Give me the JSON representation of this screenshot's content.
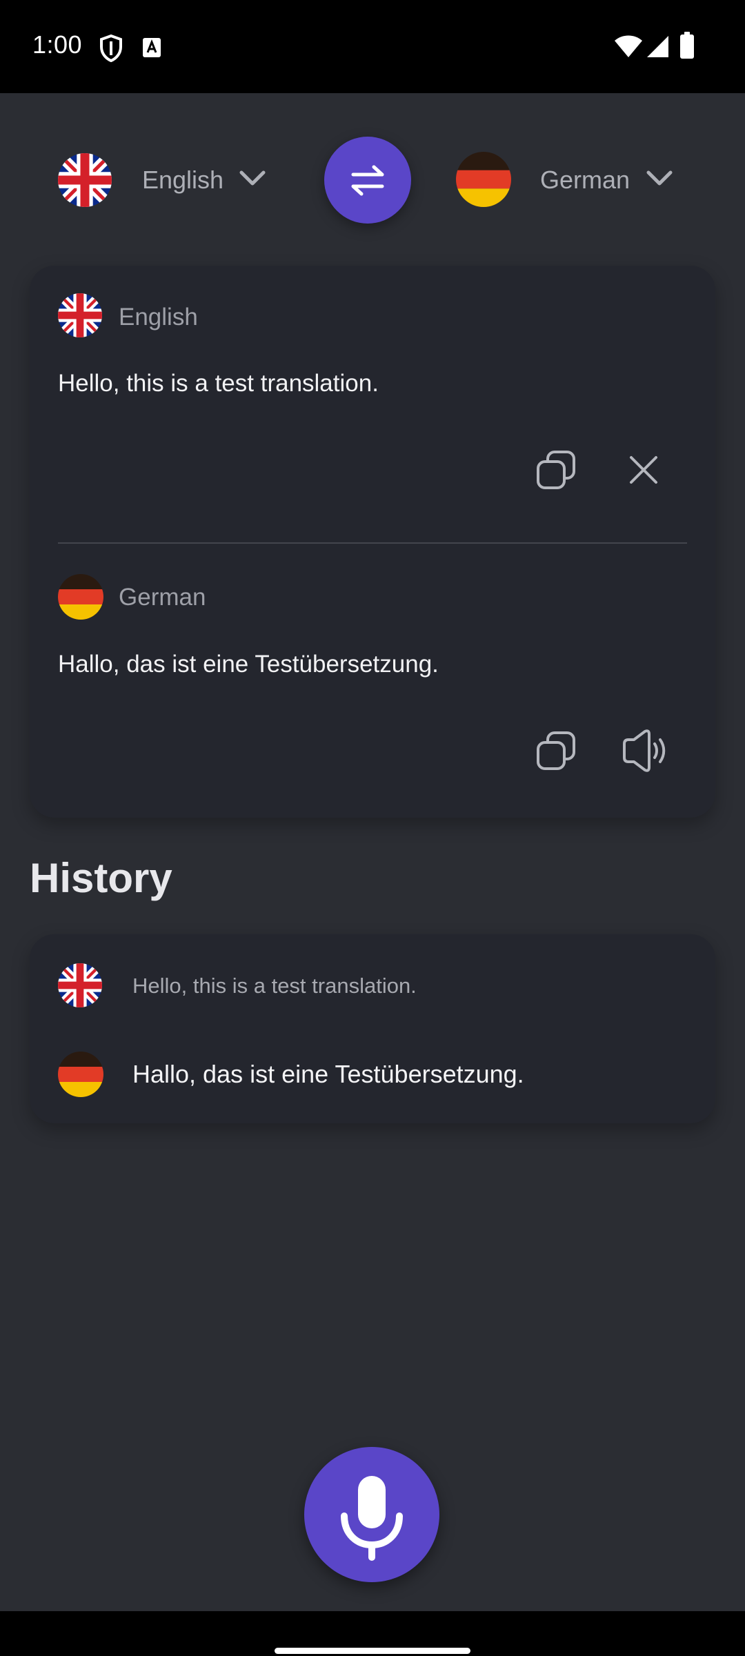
{
  "status_bar": {
    "time": "1:00",
    "icons": [
      "shield-icon",
      "keyboard-a-icon",
      "wifi-icon",
      "signal-icon",
      "battery-icon"
    ]
  },
  "language_bar": {
    "source_language": "English",
    "target_language": "German",
    "swap_icon": "swap-arrows-icon"
  },
  "translation_card": {
    "source": {
      "language": "English",
      "text": "Hello, this is a test translation.",
      "actions": [
        "copy-icon",
        "close-icon"
      ]
    },
    "target": {
      "language": "German",
      "text": "Hallo, das ist eine Testübersetzung.",
      "actions": [
        "copy-icon",
        "speaker-icon"
      ]
    }
  },
  "history": {
    "title": "History",
    "items": [
      {
        "source_text": "Hello, this is a test translation.",
        "target_text": "Hallo, das ist eine Testübersetzung."
      }
    ]
  },
  "mic_button": {
    "icon": "microphone-icon"
  },
  "colors": {
    "accent": "#5a46c8",
    "background": "#2b2d33",
    "card": "#24262e"
  }
}
